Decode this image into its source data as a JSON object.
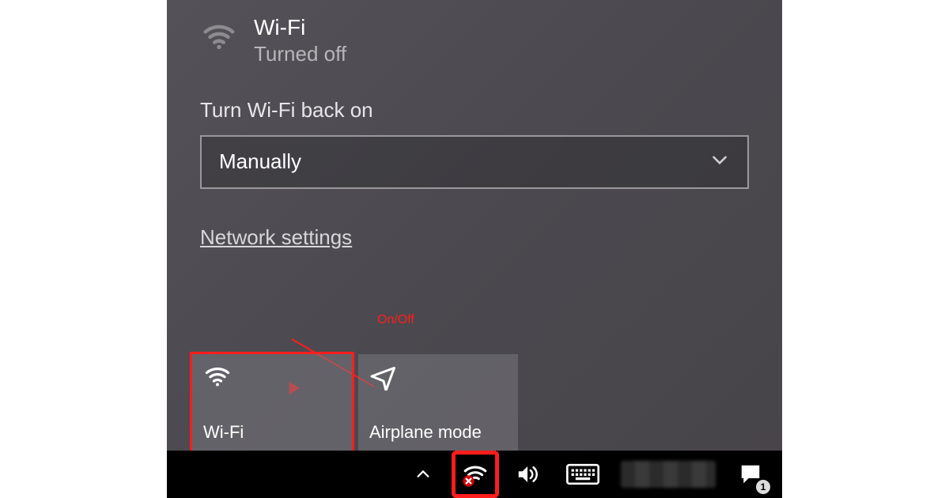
{
  "header": {
    "title": "Wi-Fi",
    "status": "Turned off"
  },
  "reconnect": {
    "label": "Turn Wi-Fi back on",
    "selected": "Manually"
  },
  "link": {
    "network_settings": "Network settings"
  },
  "tiles": {
    "wifi": "Wi-Fi",
    "airplane": "Airplane mode"
  },
  "annotation": {
    "label": "On/Off"
  },
  "tray": {
    "notification_count": "1"
  }
}
